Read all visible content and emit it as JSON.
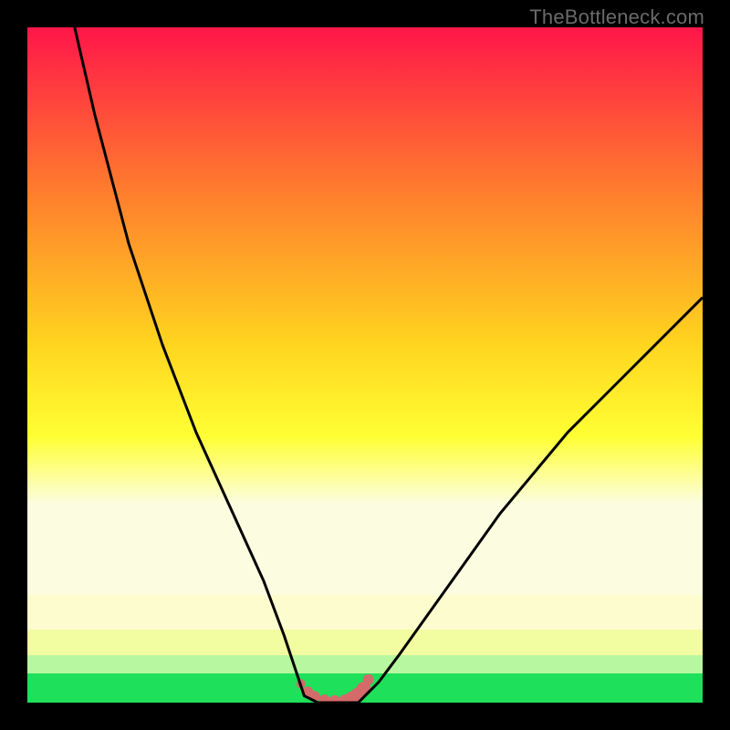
{
  "watermark": "TheBottleneck.com",
  "colors": {
    "band_green": "#1fe05a",
    "band_green_light": "#b7f7a0",
    "band_lime": "#f2fca0",
    "band_yellow_pale": "#fdfccf",
    "marker_fill": "#d46a6a",
    "curve_stroke": "#000000",
    "gradient_top": "#ff1649",
    "gradient_mid1": "#ff7a2e",
    "gradient_mid2": "#ffd21f",
    "gradient_mid3": "#ffff33",
    "gradient_bottom_fade": "#fcfde0"
  },
  "chart_data": {
    "type": "line",
    "title": "",
    "xlabel": "",
    "ylabel": "",
    "xlim": [
      0,
      100
    ],
    "ylim": [
      0,
      100
    ],
    "notes": "V-shaped bottleneck curve. x is a relative component-balance axis (0-100). y is bottleneck percentage (0-100, 0 = no bottleneck). Minimum (optimal range) lies roughly between x=41 and x=50 where y≈0. Left branch rises steeply toward y≈100 at x≈7; right branch rises more gently toward y≈60 at x=100.",
    "series": [
      {
        "name": "bottleneck-curve",
        "x": [
          7,
          10,
          15,
          20,
          25,
          30,
          35,
          38,
          40,
          41,
          43,
          45,
          47,
          49,
          50,
          52,
          55,
          60,
          65,
          70,
          75,
          80,
          85,
          90,
          95,
          100
        ],
        "y": [
          100,
          87,
          68,
          53,
          40,
          29,
          18,
          10,
          4,
          1,
          0,
          0,
          0,
          0,
          1,
          3,
          7,
          14,
          21,
          28,
          34,
          40,
          45,
          50,
          55,
          60
        ]
      }
    ],
    "optimal_markers": {
      "name": "optimal-range-points",
      "x": [
        40.5,
        41.5,
        42.5,
        44,
        45.5,
        47,
        48,
        49,
        49.8,
        50.5
      ],
      "y": [
        2.8,
        1.6,
        0.9,
        0.4,
        0.3,
        0.4,
        0.7,
        1.2,
        2.0,
        3.4
      ],
      "r": [
        5,
        6,
        6,
        6,
        6,
        6,
        7,
        8,
        8,
        6
      ]
    }
  }
}
